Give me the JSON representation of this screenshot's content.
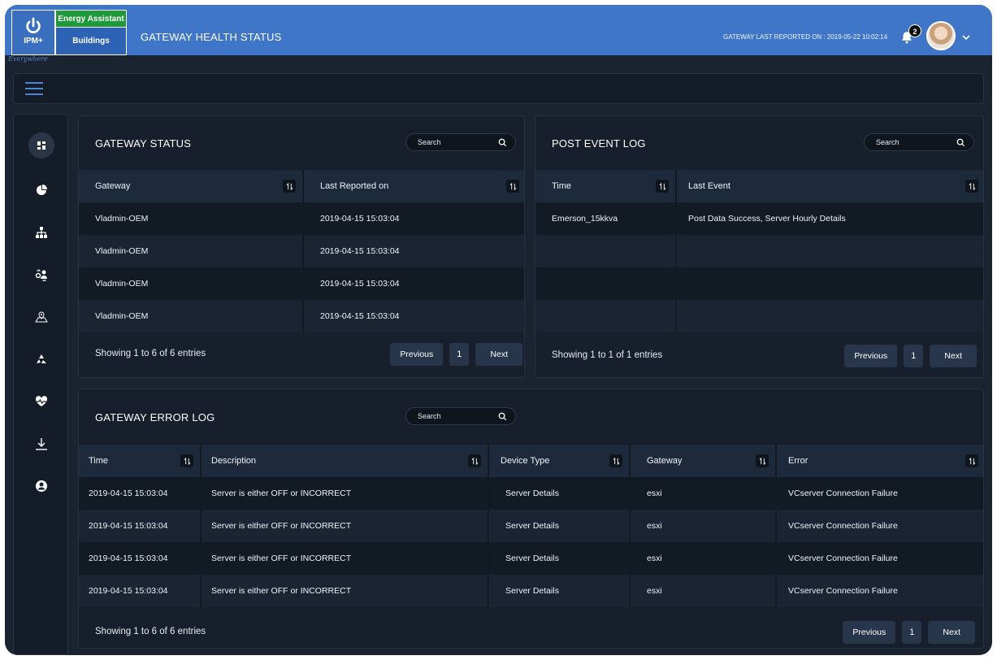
{
  "app": {
    "logo_text": "IPM+",
    "tagline": "Everywhere",
    "badge_primary": "Energy Assistant",
    "badge_secondary": "Buildings",
    "page_title": "GATEWAY HEALTH STATUS",
    "last_reported": "GATEWAY LAST REPORTED ON : 2019-05-22 10:02:14",
    "notification_count": "2",
    "colors": {
      "topbar": "#4076c7",
      "badge_green": "#1e9a3a",
      "background": "#1a2330"
    }
  },
  "sidebar": {
    "items": [
      {
        "icon": "dashboard-icon",
        "active": true
      },
      {
        "icon": "pie-chart-icon"
      },
      {
        "icon": "hierarchy-icon"
      },
      {
        "icon": "user-exchange-icon"
      },
      {
        "icon": "map-location-icon"
      },
      {
        "icon": "recycle-icon"
      },
      {
        "icon": "heartbeat-icon"
      },
      {
        "icon": "download-icon"
      },
      {
        "icon": "user-circle-icon"
      }
    ]
  },
  "gateway_status": {
    "title": "GATEWAY STATUS",
    "search_placeholder": "Search",
    "columns": [
      "Gateway",
      "Last Reported on"
    ],
    "rows": [
      [
        "Vladmin-OEM",
        "2019-04-15  15:03:04"
      ],
      [
        "Vladmin-OEM",
        "2019-04-15  15:03:04"
      ],
      [
        "Vladmin-OEM",
        "2019-04-15  15:03:04"
      ],
      [
        "Vladmin-OEM",
        "2019-04-15  15:03:04"
      ]
    ],
    "footer": "Showing 1 to 6 of 6 entries",
    "prev": "Previous",
    "page": "1",
    "next": "Next"
  },
  "post_event_log": {
    "title": "POST EVENT LOG",
    "search_placeholder": "Search",
    "columns": [
      "Time",
      "Last Event"
    ],
    "rows": [
      [
        "Emerson_15kkva",
        "Post Data Success, Server Hourly Details"
      ],
      [
        "",
        ""
      ],
      [
        "",
        ""
      ],
      [
        "",
        ""
      ]
    ],
    "footer": "Showing 1 to 1 of 1 entries",
    "prev": "Previous",
    "page": "1",
    "next": "Next"
  },
  "gateway_error_log": {
    "title": "GATEWAY ERROR LOG",
    "search_placeholder": "Search",
    "columns": [
      "Time",
      "Description",
      "Device Type",
      "Gateway",
      "Error"
    ],
    "rows": [
      [
        "2019-04-15  15:03:04",
        "Server is either OFF or INCORRECT",
        "Server Details",
        "esxi",
        "VCserver Connection Failure"
      ],
      [
        "2019-04-15  15:03:04",
        "Server is either OFF or INCORRECT",
        "Server Details",
        "esxi",
        "VCserver Connection Failure"
      ],
      [
        "2019-04-15  15:03:04",
        "Server is either OFF or INCORRECT",
        "Server Details",
        "esxi",
        "VCserver Connection Failure"
      ],
      [
        "2019-04-15  15:03:04",
        "Server is either OFF or INCORRECT",
        "Server Details",
        "esxi",
        "VCserver Connection Failure"
      ]
    ],
    "footer": "Showing 1 to 6 of 6 entries",
    "prev": "Previous",
    "page": "1",
    "next": "Next"
  }
}
